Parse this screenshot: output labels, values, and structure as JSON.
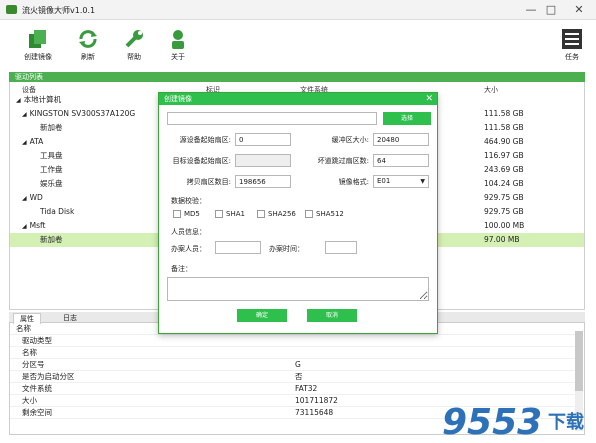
{
  "app": {
    "title": "流火镜像大师v1.0.1"
  },
  "toolbar": {
    "create_label": "创建镜像",
    "refresh_label": "刷新",
    "help_label": "帮助",
    "about_label": "关于",
    "tasks_label": "任务"
  },
  "list": {
    "header": "驱动列表",
    "columns": {
      "device": "设备",
      "label": "标识",
      "fs": "文件系统",
      "size": "大小"
    },
    "rows": [
      {
        "name": "本地计算机",
        "size": ""
      },
      {
        "name": "KINGSTON SV300S37A120G",
        "size": "111.58 GB"
      },
      {
        "name": "新加卷",
        "size": "111.58 GB"
      },
      {
        "name": "ATA",
        "size": "464.90 GB"
      },
      {
        "name": "工具盘",
        "size": "116.97 GB"
      },
      {
        "name": "工作盘",
        "size": "243.69 GB"
      },
      {
        "name": "娱乐盘",
        "size": "104.24 GB"
      },
      {
        "name": "WD",
        "size": "929.75 GB"
      },
      {
        "name": "Tida Disk",
        "size": "929.75 GB"
      },
      {
        "name": "Msft",
        "size": "100.00 MB"
      },
      {
        "name": "新加卷",
        "size": "97.00 MB"
      }
    ]
  },
  "props": {
    "tabs": [
      "属性",
      "日志"
    ],
    "header": "名称",
    "rows": [
      {
        "k": "驱动类型",
        "v": ""
      },
      {
        "k": "名称",
        "v": ""
      },
      {
        "k": "分区号",
        "v": "G"
      },
      {
        "k": "是否为启动分区",
        "v": "否"
      },
      {
        "k": "文件系统",
        "v": "FAT32"
      },
      {
        "k": "大小",
        "v": "101711872"
      },
      {
        "k": "剩余空间",
        "v": "73115648"
      }
    ]
  },
  "dialog": {
    "title": "创建镜像",
    "path_value": "",
    "browse_label": "选择",
    "src_start_label": "源设备起始扇区:",
    "src_start_value": "0",
    "buffer_label": "缓冲区大小:",
    "buffer_value": "20480",
    "dst_start_label": "目标设备起始扇区:",
    "dst_start_value": "",
    "bad_skip_label": "坏道跳过扇区数:",
    "bad_skip_value": "64",
    "copy_count_label": "拷贝扇区数目:",
    "copy_count_value": "198656",
    "format_label": "镜像格式:",
    "format_value": "E01",
    "checksum_label": "数据校验：",
    "checksums": [
      "MD5",
      "SHA1",
      "SHA256",
      "SHA512"
    ],
    "person_label": "人员信息：",
    "operator_label": "办案人员：",
    "time_label": "办案时间：",
    "remark_label": "备注：",
    "ok_label": "确定",
    "cancel_label": "取消"
  },
  "watermark": {
    "text": "9553",
    "sub": "下载"
  }
}
